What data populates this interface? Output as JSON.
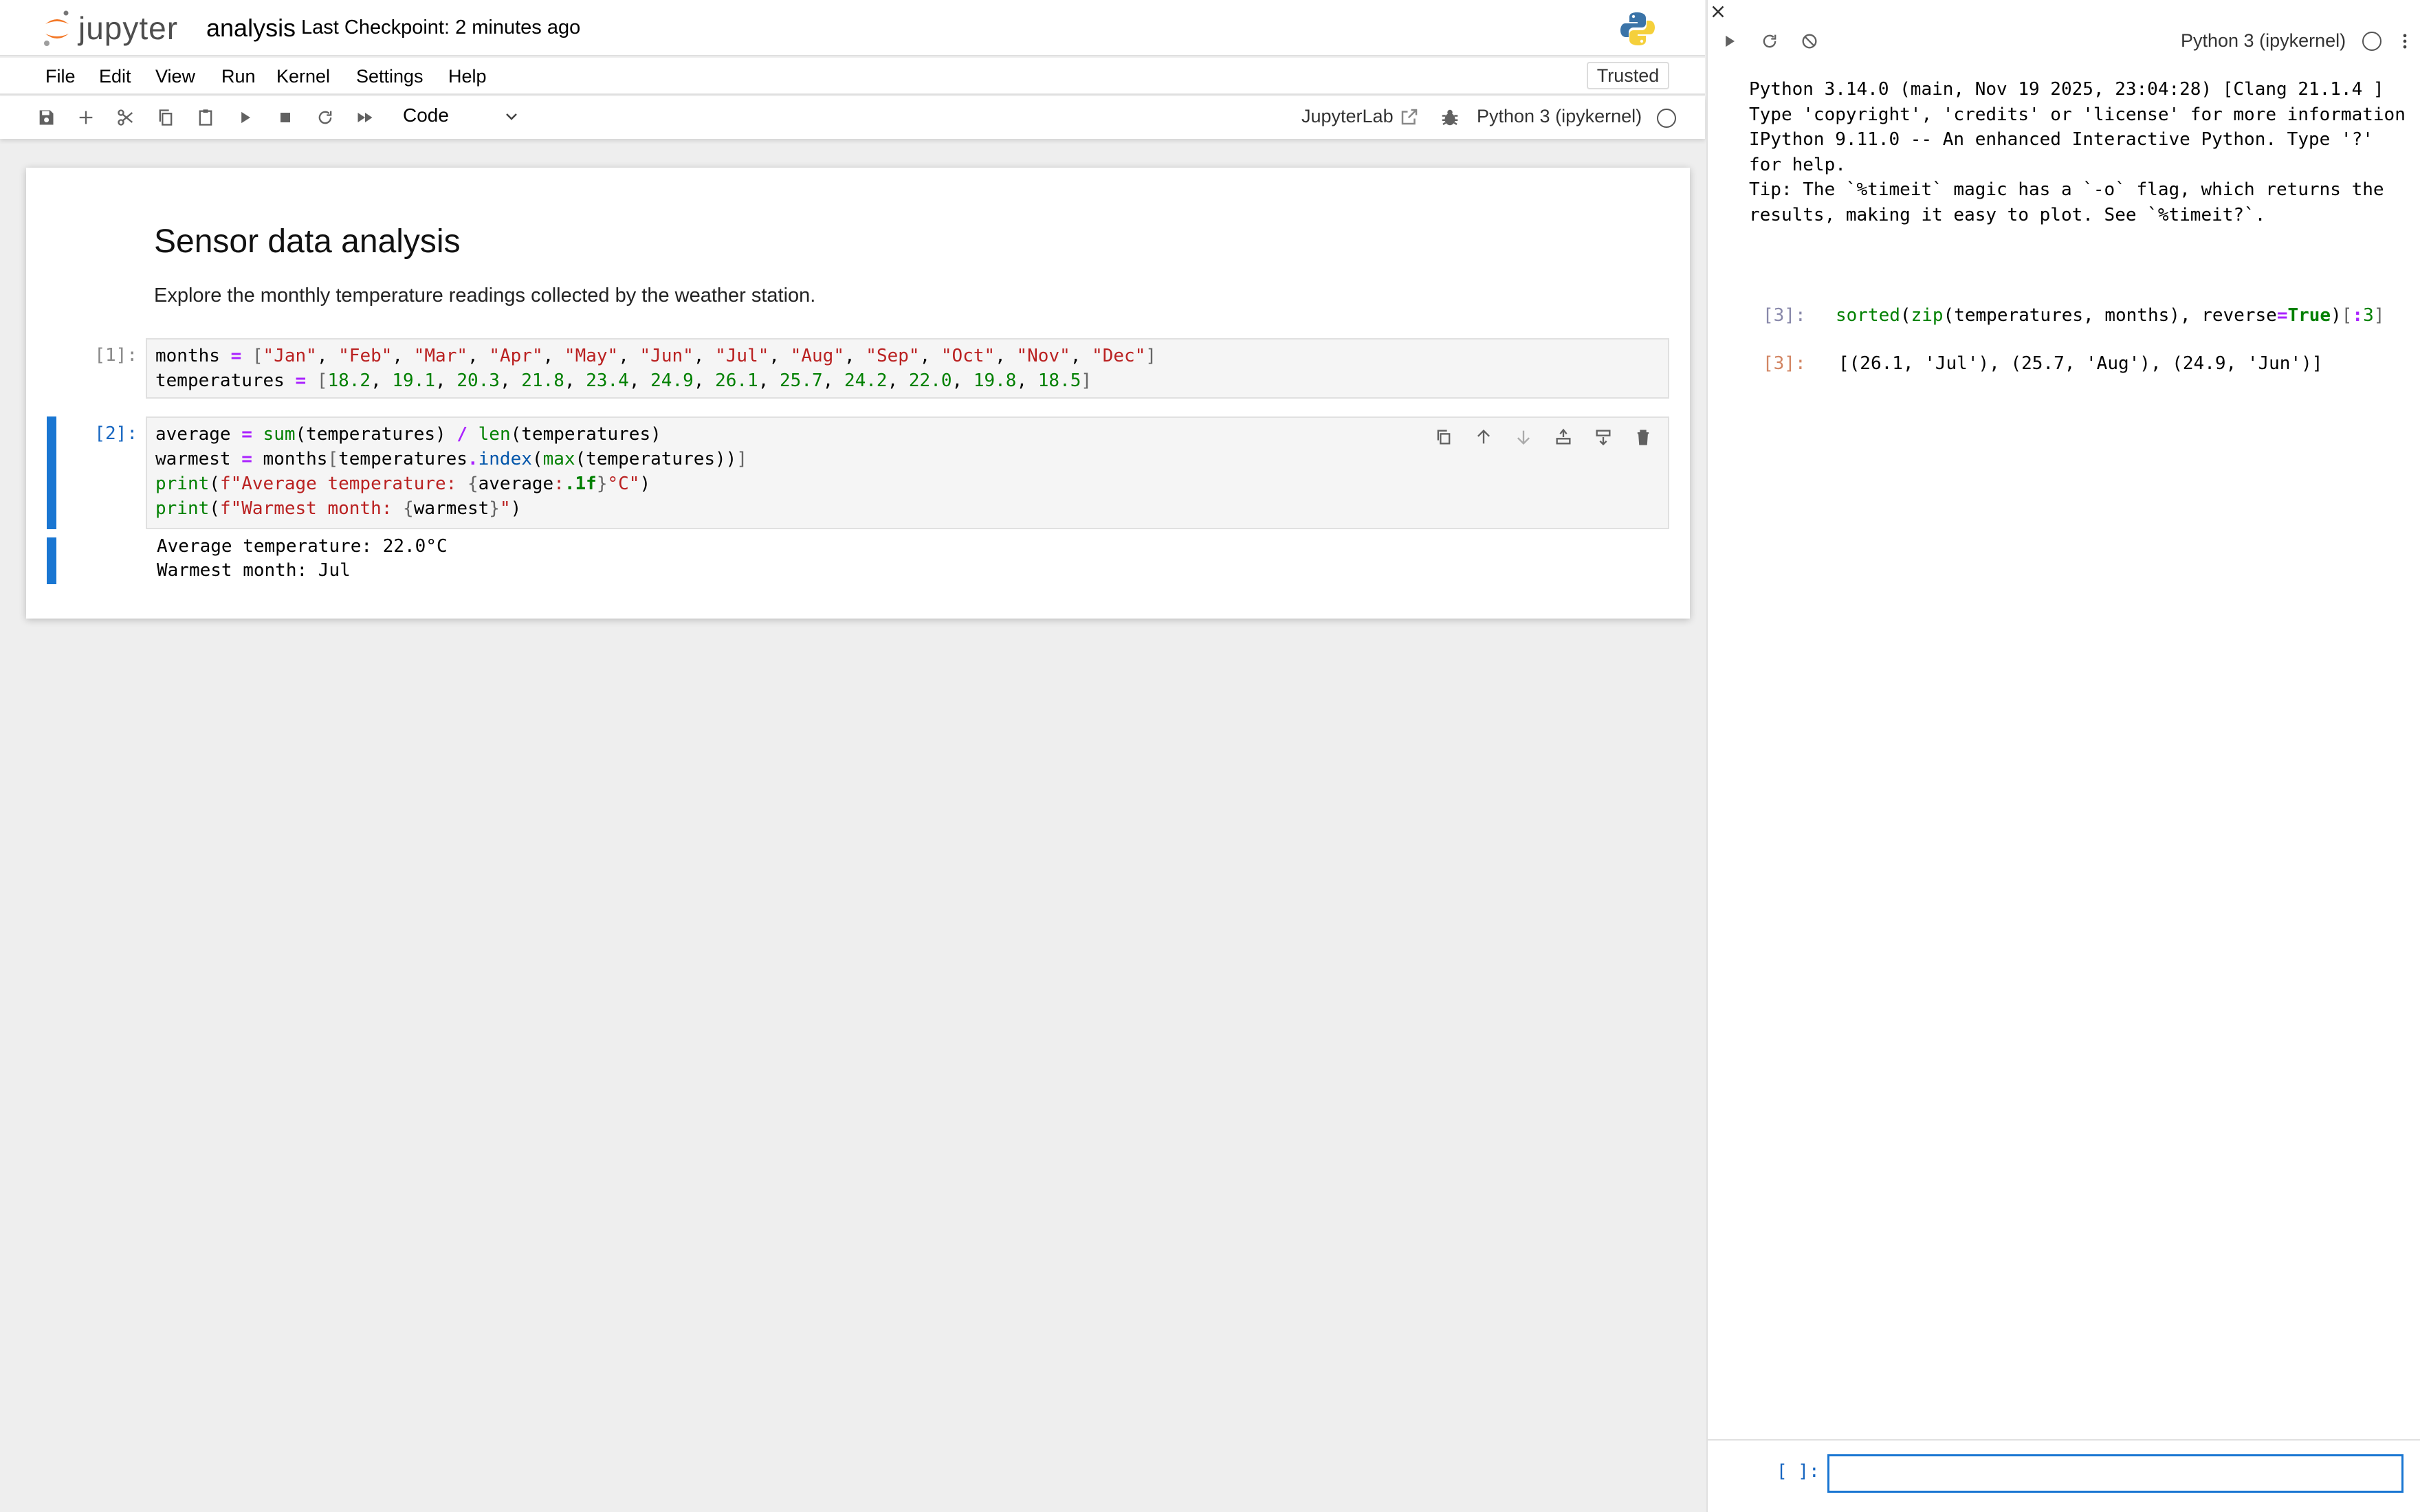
{
  "header": {
    "logo_text": "jupyter",
    "notebook_title": "analysis",
    "checkpoint": "Last Checkpoint: 2 minutes ago"
  },
  "menu": {
    "items": [
      "File",
      "Edit",
      "View",
      "Run",
      "Kernel",
      "Settings",
      "Help"
    ],
    "trusted": "Trusted"
  },
  "toolbar": {
    "cell_type": "Code",
    "open_in": "JupyterLab",
    "kernel": "Python 3 (ipykernel)"
  },
  "notebook": {
    "md_title": "Sensor data analysis",
    "md_text": "Explore the monthly temperature readings collected by the weather station.",
    "cell1_prompt": "[1]:",
    "cell2_prompt": "[2]:",
    "cell2_output": "Average temperature: 22.0°C\nWarmest month: Jul"
  },
  "console": {
    "kernel": "Python 3 (ipykernel)",
    "banner": "Python 3.14.0 (main, Nov 19 2025, 23:04:28) [Clang 21.1.4 ]\nType 'copyright', 'credits' or 'license' for more information\nIPython 9.11.0 -- An enhanced Interactive Python. Type '?' for help.\nTip: The `%timeit` magic has a `-o` flag, which returns the results, making it easy to plot. See `%timeit?`.",
    "in_prompt": "[3]:",
    "out_prompt": "[3]:",
    "output": "[(26.1, 'Jul'), (25.7, 'Aug'), (24.9, 'Jun')]",
    "input_prompt": "[ ]:",
    "input_value": ""
  },
  "colors": {
    "accent": "#1976d2",
    "jupyter_orange": "#f37726"
  }
}
